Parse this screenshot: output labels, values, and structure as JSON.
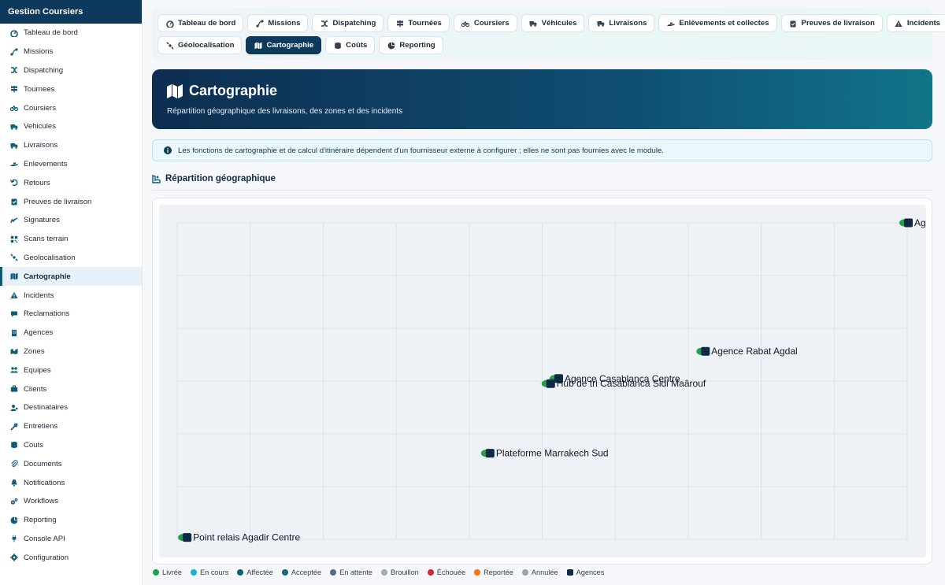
{
  "app": {
    "title": "Gestion Coursiers"
  },
  "sidebar": {
    "items": [
      {
        "label": "Tableau de bord",
        "icon": "dashboard-icon"
      },
      {
        "label": "Missions",
        "icon": "route-icon"
      },
      {
        "label": "Dispatching",
        "icon": "shuffle-icon"
      },
      {
        "label": "Tournees",
        "icon": "signs-icon"
      },
      {
        "label": "Coursiers",
        "icon": "bicycle-icon"
      },
      {
        "label": "Vehicules",
        "icon": "truck-icon"
      },
      {
        "label": "Livraisons",
        "icon": "delivery-truck-icon"
      },
      {
        "label": "Enlevements",
        "icon": "hand-box-icon"
      },
      {
        "label": "Retours",
        "icon": "undo-icon"
      },
      {
        "label": "Preuves de livraison",
        "icon": "clipboard-check-icon"
      },
      {
        "label": "Signatures",
        "icon": "signature-icon"
      },
      {
        "label": "Scans terrain",
        "icon": "qrcode-icon"
      },
      {
        "label": "Geolocalisation",
        "icon": "satellite-icon"
      },
      {
        "label": "Cartographie",
        "icon": "map-icon",
        "active": true
      },
      {
        "label": "Incidents",
        "icon": "warning-icon"
      },
      {
        "label": "Reclamations",
        "icon": "comment-icon"
      },
      {
        "label": "Agences",
        "icon": "building-icon"
      },
      {
        "label": "Zones",
        "icon": "map-marked-icon"
      },
      {
        "label": "Equipes",
        "icon": "users-icon"
      },
      {
        "label": "Clients",
        "icon": "briefcase-icon"
      },
      {
        "label": "Destinataires",
        "icon": "user-tag-icon"
      },
      {
        "label": "Entretiens",
        "icon": "tools-icon"
      },
      {
        "label": "Couts",
        "icon": "coins-icon"
      },
      {
        "label": "Documents",
        "icon": "paperclip-icon"
      },
      {
        "label": "Notifications",
        "icon": "bell-icon"
      },
      {
        "label": "Workflows",
        "icon": "cogs-icon"
      },
      {
        "label": "Reporting",
        "icon": "chart-pie-icon"
      },
      {
        "label": "Console API",
        "icon": "plug-icon"
      },
      {
        "label": "Configuration",
        "icon": "cog-icon"
      }
    ]
  },
  "tabs": {
    "row1": [
      {
        "label": "Tableau de bord",
        "icon": "dashboard-icon"
      },
      {
        "label": "Missions",
        "icon": "route-icon"
      },
      {
        "label": "Dispatching",
        "icon": "shuffle-icon"
      },
      {
        "label": "Tournées",
        "icon": "signs-icon"
      },
      {
        "label": "Coursiers",
        "icon": "bicycle-icon"
      },
      {
        "label": "Véhicules",
        "icon": "truck-icon"
      },
      {
        "label": "Livraisons",
        "icon": "delivery-truck-icon"
      },
      {
        "label": "Enlèvements et collectes",
        "icon": "hand-box-icon"
      },
      {
        "label": "Preuves de livraison",
        "icon": "clipboard-check-icon"
      },
      {
        "label": "Incidents",
        "icon": "warning-icon"
      }
    ],
    "row2": [
      {
        "label": "Géolocalisation",
        "icon": "satellite-icon"
      },
      {
        "label": "Cartographie",
        "icon": "map-icon",
        "active": true
      },
      {
        "label": "Coûts",
        "icon": "coins-icon"
      },
      {
        "label": "Reporting",
        "icon": "chart-pie-icon"
      }
    ]
  },
  "hero": {
    "title": "Cartographie",
    "subtitle": "Répartition géographique des livraisons, des zones et des incidents"
  },
  "alert": {
    "text": "Les fonctions de cartographie et de calcul d'itinéraire dépendent d'un fournisseur externe à configurer ; elles ne sont pas fournies avec le module."
  },
  "section": {
    "title": "Répartition géographique"
  },
  "map": {
    "grid_cols": 10,
    "grid_rows": 6,
    "points": [
      {
        "label": "Agence",
        "x": 1.0,
        "y": 1.0
      },
      {
        "label": "Agence Rabat Agdal",
        "x": 0.722,
        "y": 0.594
      },
      {
        "label": "Agence Casablanca Centre",
        "x": 0.521,
        "y": 0.508
      },
      {
        "label": "Hub de tri Casablanca Sidi Maârouf",
        "x": 0.51,
        "y": 0.492
      },
      {
        "label": "Plateforme Marrakech Sud",
        "x": 0.427,
        "y": 0.272
      },
      {
        "label": "Point relais Agadir Centre",
        "x": 0.012,
        "y": 0.006
      }
    ]
  },
  "legend": [
    {
      "label": "Livrée",
      "color": "#22a04b",
      "shape": "dot"
    },
    {
      "label": "En cours",
      "color": "#17b3d1",
      "shape": "dot"
    },
    {
      "label": "Affectée",
      "color": "#0d5c7a",
      "shape": "dot"
    },
    {
      "label": "Acceptée",
      "color": "#116b7b",
      "shape": "dot"
    },
    {
      "label": "En attente",
      "color": "#5a6b80",
      "shape": "dot"
    },
    {
      "label": "Brouillon",
      "color": "#a3aab6",
      "shape": "dot"
    },
    {
      "label": "Échouée",
      "color": "#dc2626",
      "shape": "dot"
    },
    {
      "label": "Reportée",
      "color": "#f97316",
      "shape": "dot"
    },
    {
      "label": "Annulée",
      "color": "#9ca3af",
      "shape": "dot"
    },
    {
      "label": "Agences",
      "color": "#0f2a44",
      "shape": "square"
    }
  ]
}
